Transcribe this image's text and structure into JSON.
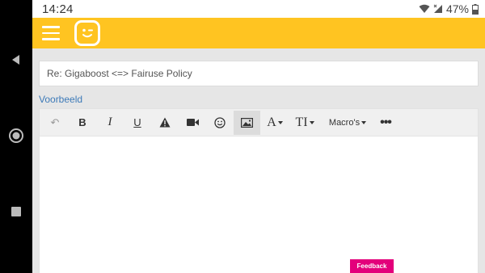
{
  "status_bar": {
    "time": "14:24",
    "battery": "47%",
    "icons": [
      "wifi-icon",
      "signal-icon",
      "battery-icon"
    ]
  },
  "android_nav": {
    "buttons": [
      "back-icon",
      "home-icon",
      "recents-icon"
    ]
  },
  "header": {
    "menu_icon": "hamburger-menu-icon",
    "logo_icon": "telenet-logo-icon",
    "background": "#ffc421"
  },
  "composer": {
    "subject": "Re: Gigaboost <=> Fairuse Policy",
    "preview_link": "Voorbeeld",
    "toolbar": {
      "undo": "↶",
      "bold": "B",
      "italic": "I",
      "underline": "U",
      "font_glyph": "A",
      "size_glyph": "TI",
      "macros": "Macro's",
      "more": "•••"
    }
  },
  "feedback_button": "Feedback",
  "colors": {
    "accent": "#ffc421",
    "link": "#3d7ab8",
    "feedback": "#e3007b"
  }
}
